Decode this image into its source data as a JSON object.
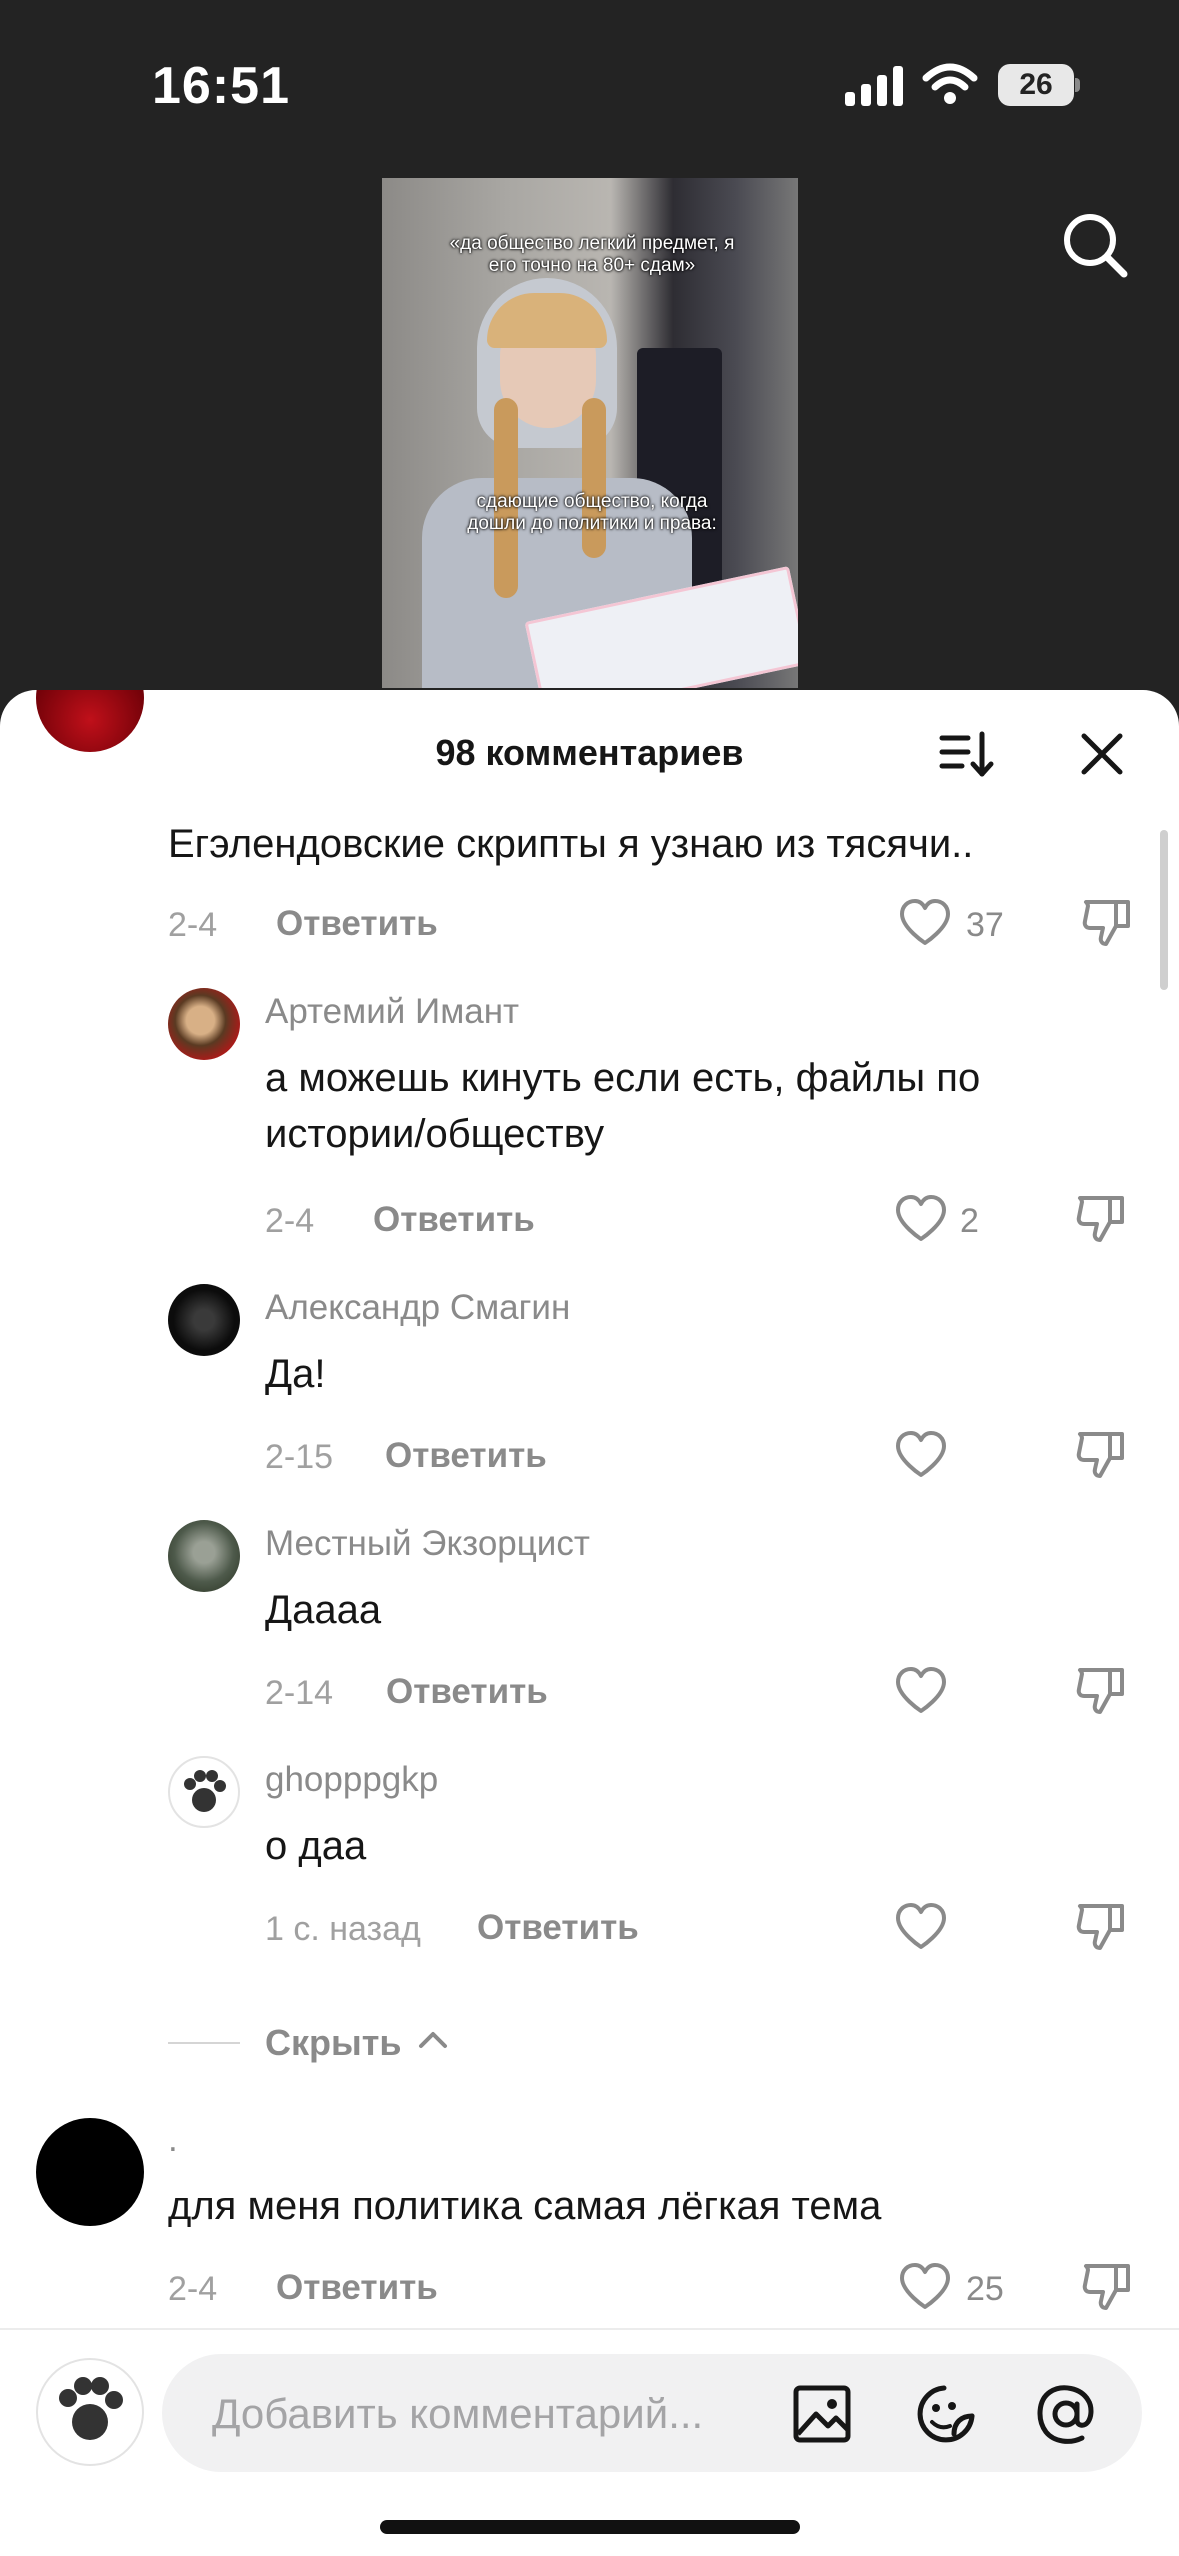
{
  "status_bar": {
    "time": "16:51",
    "battery": "26"
  },
  "video": {
    "caption_top": "«да общество легкий предмет, я его точно на 80+ сдам»",
    "caption_bottom": "сдающие общество, когда дошли до политики и права:"
  },
  "icons": {
    "search": "search-icon",
    "sort": "sort-icon",
    "close": "close-icon",
    "like": "heart-icon",
    "dislike": "dislike-icon",
    "image": "image-icon",
    "emoji": "emoji-icon",
    "mention": "at-icon"
  },
  "comments_sheet": {
    "count_label": "98 комментариев",
    "comments": [
      {
        "name": "",
        "text": "Егэлендовские скрипты я узнаю из тясячи..",
        "date": "2-4",
        "reply": "Ответить",
        "likes": "37"
      },
      {
        "name": "Артемий Имант",
        "text": "а можешь кинуть если есть, файлы по истории/обществу",
        "date": "2-4",
        "reply": "Ответить",
        "likes": "2"
      },
      {
        "name": "Александр Смагин",
        "text": "Да!",
        "date": "2-15",
        "reply": "Ответить",
        "likes": ""
      },
      {
        "name": "Местный Экзорцист",
        "text": "Даааа",
        "date": "2-14",
        "reply": "Ответить",
        "likes": ""
      },
      {
        "name": "ghopppgkp",
        "text": "о даа",
        "date": "1 с. назад",
        "reply": "Ответить",
        "likes": ""
      },
      {
        "name": ".",
        "text": "для меня политика самая лёгкая тема",
        "date": "2-4",
        "reply": "Ответить",
        "likes": "25"
      }
    ],
    "hide_label": "Скрыть"
  },
  "composer": {
    "placeholder": "Добавить комментарий..."
  }
}
